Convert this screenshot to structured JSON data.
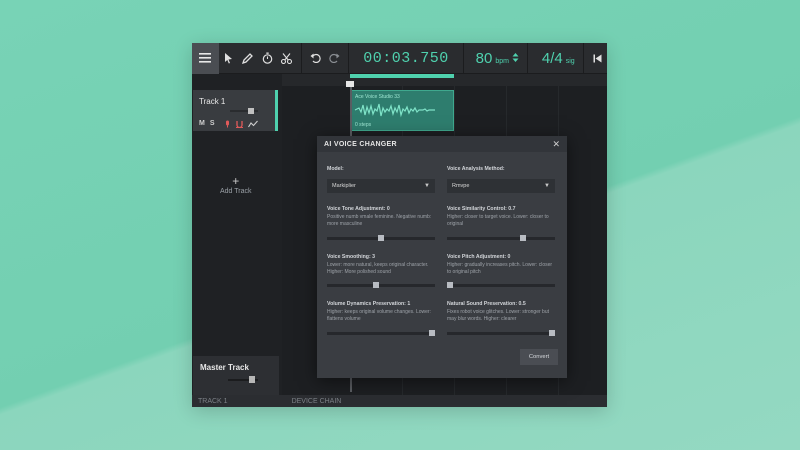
{
  "toolbar": {
    "time": "00:03.750",
    "bpm_value": "80",
    "bpm_unit": "bpm",
    "time_sig": "4/4",
    "time_sig_unit": "sig"
  },
  "tracks": {
    "track1_name": "Track 1",
    "track1_buttons": [
      "M",
      "S"
    ],
    "add_track_label": "Add Track",
    "master_name": "Master Track",
    "track1_volume": 0.7,
    "master_volume": 0.75
  },
  "clip": {
    "title": "Ace Voice Studio 33",
    "sub": "0 steps"
  },
  "bottom": {
    "left_label": "TRACK 1",
    "right_label": "DEVICE CHAIN"
  },
  "modal": {
    "title": "AI VOICE CHANGER",
    "model_label": "Model:",
    "model_value": "Markiplier",
    "method_label": "Voice Analysis Method:",
    "method_value": "Rmvpe",
    "tone_label": "Voice Tone Adjustment: 0",
    "tone_desc": "Positive numb vmale feminine. Negative numb: more masculine",
    "tone_value": 0.5,
    "similarity_label": "Voice Similarity Control: 0.7",
    "similarity_desc": "Higher: closer to target voice. Lower: closer to original",
    "similarity_value": 0.7,
    "smoothing_label": "Voice Smoothing: 3",
    "smoothing_desc": "Lower: more natural, keeps original character. Higher: More polished sound",
    "smoothing_value": 0.45,
    "pitch_label": "Voice Pitch Adjustment: 0",
    "pitch_desc": "Higher: gradually increases pitch. Lower: closer to original pitch",
    "pitch_value": 0.0,
    "dynamics_label": "Volume Dynamics Preservation: 1",
    "dynamics_desc": "Higher: keeps original volume changes. Lower: flattens volume",
    "dynamics_value": 0.98,
    "natural_label": "Natural Sound Preservation: 0.5",
    "natural_desc": "Fixes robot voice glitches. Lower: stronger but may blur words. Higher: clearer",
    "natural_value": 0.98,
    "convert_label": "Convert"
  },
  "colors": {
    "accent": "#4fd1ae",
    "background": "#6fcdb0"
  }
}
